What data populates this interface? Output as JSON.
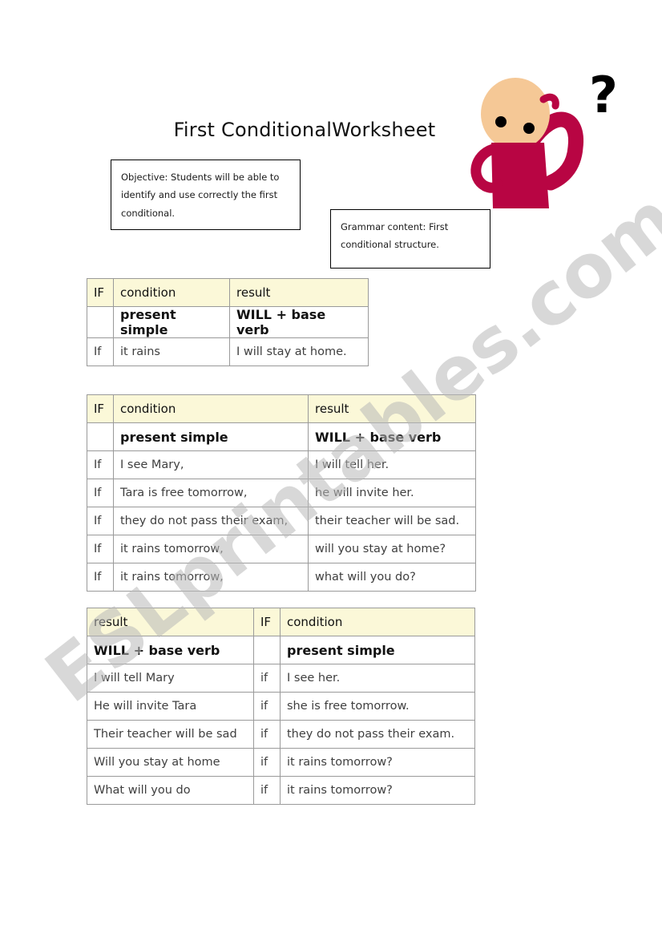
{
  "document": {
    "title": "First ConditionalWorksheet",
    "watermark": "ESLprintables.com"
  },
  "objective_box": {
    "text": "Objective: Students will be able to identify and use correctly the first conditional."
  },
  "grammar_box": {
    "text": "Grammar content: First conditional structure."
  },
  "illustration": {
    "name": "thinking-person",
    "question_mark": "?",
    "colors": {
      "skin": "#f5c896",
      "shirt": "#b80543",
      "eyes": "#000000",
      "question_mark": "#000000"
    }
  },
  "tables": [
    {
      "id": "table1",
      "headers": [
        "IF",
        "condition",
        "result"
      ],
      "formula_row": [
        "",
        "present simple",
        "WILL + base verb"
      ],
      "rows": [
        [
          "If",
          "it rains",
          "I will stay at home."
        ]
      ]
    },
    {
      "id": "table2",
      "headers": [
        "IF",
        "condition",
        "result"
      ],
      "formula_row": [
        "",
        "present simple",
        "WILL + base verb"
      ],
      "rows": [
        [
          "If",
          "I see Mary,",
          "I will tell her."
        ],
        [
          "If",
          "Tara is free tomorrow,",
          "he will invite her."
        ],
        [
          "If",
          "they do not pass their exam,",
          "their teacher will be sad."
        ],
        [
          "If",
          "it rains tomorrow,",
          "will you stay at home?"
        ],
        [
          "If",
          "it rains tomorrow,",
          "what will you do?"
        ]
      ]
    },
    {
      "id": "table3",
      "headers": [
        "result",
        "IF",
        "condition"
      ],
      "formula_row": [
        "WILL + base verb",
        "",
        "present simple"
      ],
      "rows": [
        [
          "I will tell Mary",
          "if",
          "I see her."
        ],
        [
          "He will invite Tara",
          "if",
          "she is free tomorrow."
        ],
        [
          "Their teacher will be sad",
          "if",
          "they do not pass their exam."
        ],
        [
          "Will you stay at home",
          "if",
          "it rains tomorrow?"
        ],
        [
          "What will you do",
          "if",
          "it rains tomorrow?"
        ]
      ]
    }
  ]
}
